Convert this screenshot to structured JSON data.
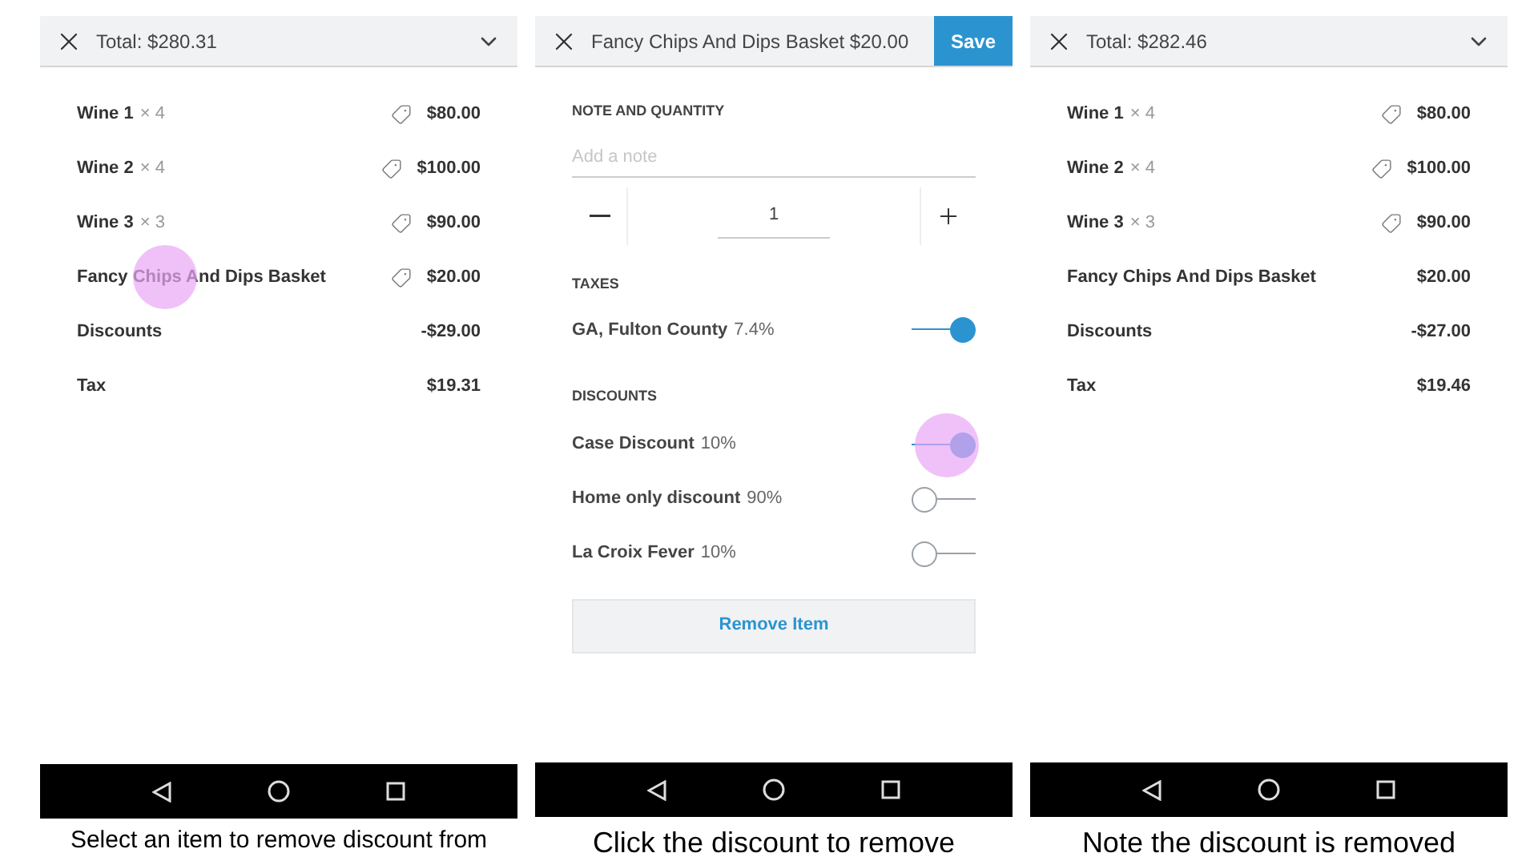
{
  "panels": [
    {
      "kind": "cart",
      "header": {
        "title": "Total: $280.31"
      },
      "rows": [
        {
          "name": "Wine 1",
          "qty": "× 4",
          "tagged": true,
          "price": "$80.00",
          "tapped": false
        },
        {
          "name": "Wine 2",
          "qty": "× 4",
          "tagged": true,
          "price": "$100.00",
          "tapped": false
        },
        {
          "name": "Wine 3",
          "qty": "× 3",
          "tagged": true,
          "price": "$90.00",
          "tapped": false
        },
        {
          "name": "Fancy Chips And Dips Basket",
          "tagged": true,
          "price": "$20.00",
          "tapped": true
        },
        {
          "name": "Discounts",
          "tagged": false,
          "price": "-$29.00",
          "tapped": false
        },
        {
          "name": "Tax",
          "tagged": false,
          "price": "$19.31",
          "tapped": false
        }
      ],
      "caption": "Select an item to remove discount from"
    },
    {
      "kind": "edit",
      "header": {
        "title": "Fancy Chips And Dips Basket $20.00",
        "save": "Save"
      },
      "note_section": "NOTE AND QUANTITY",
      "note": {
        "placeholder": "Add a note"
      },
      "quantity": "1",
      "taxes_section": "TAXES",
      "taxes": [
        {
          "name": "GA, Fulton County",
          "rate": "7.4%",
          "on": true,
          "tapped": false
        }
      ],
      "discounts_section": "DISCOUNTS",
      "discounts": [
        {
          "name": "Case Discount",
          "rate": "10%",
          "on": true,
          "tapped": true
        },
        {
          "name": "Home only discount",
          "rate": "90%",
          "on": false,
          "tapped": false
        },
        {
          "name": "La Croix Fever",
          "rate": "10%",
          "on": false,
          "tapped": false
        }
      ],
      "remove": "Remove Item",
      "caption": "Click the discount to remove"
    },
    {
      "kind": "cart",
      "header": {
        "title": "Total: $282.46"
      },
      "rows": [
        {
          "name": "Wine 1",
          "qty": "× 4",
          "tagged": true,
          "price": "$80.00",
          "tapped": false
        },
        {
          "name": "Wine 2",
          "qty": "× 4",
          "tagged": true,
          "price": "$100.00",
          "tapped": false
        },
        {
          "name": "Wine 3",
          "qty": "× 3",
          "tagged": true,
          "price": "$90.00",
          "tapped": false
        },
        {
          "name": "Fancy Chips And Dips Basket",
          "tagged": false,
          "price": "$20.00",
          "tapped": false
        },
        {
          "name": "Discounts",
          "tagged": false,
          "price": "-$27.00",
          "tapped": false
        },
        {
          "name": "Tax",
          "tagged": false,
          "price": "$19.46",
          "tapped": false
        }
      ],
      "caption": "Note the discount is removed"
    }
  ]
}
